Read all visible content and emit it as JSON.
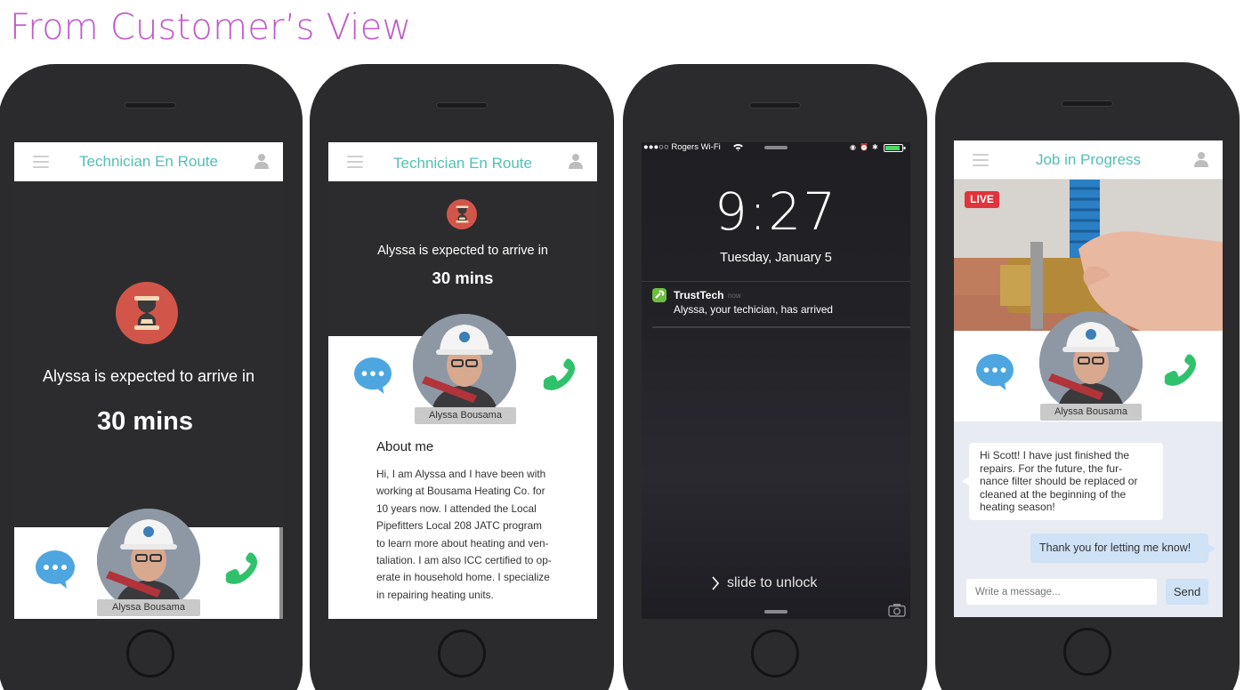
{
  "page": {
    "title": "From Customer’s View"
  },
  "colors": {
    "accent": "#52bfb5",
    "title": "#c058c9",
    "hourglass": "#d2554a",
    "chat": "#4da6e0",
    "call": "#2fc26b",
    "live": "#e0343a"
  },
  "phone1": {
    "header_title": "Technician En Route",
    "eta_label": "Alyssa is expected to arrive in",
    "eta_value": "30 mins",
    "tech_name": "Alyssa Bousama"
  },
  "phone2": {
    "header_title": "Technician En Route",
    "eta_label": "Alyssa is expected to arrive in",
    "eta_value": "30 mins",
    "tech_name": "Alyssa Bousama",
    "about_title": "About me",
    "about_lines": [
      "Hi, I am Alyssa and I have been with",
      "working at Bousama Heating Co. for",
      "10 years now. I attended the Local",
      "Pipefitters Local 208 JATC program",
      "to learn more about heating and ven-",
      "taliation. I am also ICC certified to op-",
      "erate in household home. I specialize",
      "in repairing heating units."
    ]
  },
  "phone3": {
    "carrier": "●●●○○ Rogers Wi-Fi",
    "time": "9:27",
    "date": "Tuesday, January 5",
    "notif_app": "TrustTech",
    "notif_when": "now",
    "notif_text": "Alyssa, your techician, has arrived",
    "slide_text": "slide to unlock"
  },
  "phone4": {
    "header_title": "Job in Progress",
    "live_badge": "LIVE",
    "tech_name": "Alyssa Bousama",
    "msg_in_lines": [
      "Hi Scott! I have just finished the",
      "repairs. For the future, the fur-",
      "nance filter should be replaced or",
      "cleaned at the beginning of the",
      "heating season!"
    ],
    "msg_out": "Thank you for letting me know!",
    "input_placeholder": "Write a message...",
    "send_label": "Send"
  },
  "icons": [
    "menu-icon",
    "user-icon",
    "hourglass-icon",
    "chat-icon",
    "phone-icon",
    "wifi-icon",
    "battery-icon",
    "camera-icon",
    "chevron-right-icon",
    "app-icon"
  ]
}
